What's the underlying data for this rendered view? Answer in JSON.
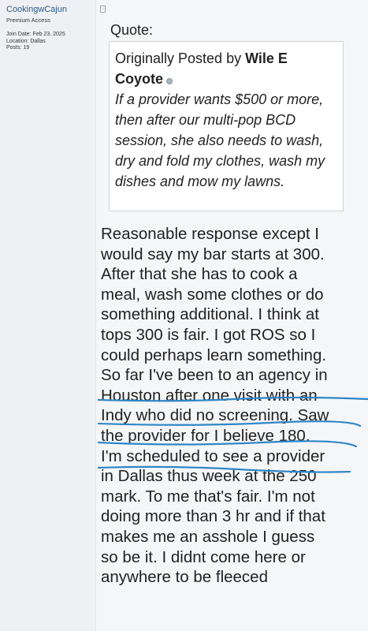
{
  "user": {
    "name": "CookingwCajun",
    "rank": "Premium Access",
    "join_date": "Join Date: Feb 23, 2025",
    "location": "Location: Dallas",
    "posts": "Posts: 19"
  },
  "post": {
    "icon": "post-document-icon",
    "quote_label": "Quote:",
    "quote": {
      "prefix": "Originally Posted by ",
      "author": "Wile E Coyote",
      "text": "If a provider wants $500 or more, then after our multi-pop BCD session, she also needs to wash, dry and fold my clothes, wash my dishes and mow my lawns."
    },
    "body": "Reasonable response except I\nwould say my bar starts at 300.\nAfter that she has to cook a\nmeal, wash some clothes or do\nsomething additional. I think at\ntops 300 is fair. I got ROS so I\ncould perhaps learn something.\nSo far I've been to an agency in\nHouston after one visit with an\nIndy who did no screening. Saw\nthe provider for I believe 180.\nI'm scheduled to see a provider\nin Dallas thus week at the 250\nmark. To me that's fair. I'm not\ndoing more than 3 hr and if that\nmakes me an asshole I guess\nso be it. I didnt come here or\nanywhere to be fleeced"
  },
  "colors": {
    "username": "#2a5d8f",
    "annotation_underline": "#2f86c8"
  }
}
